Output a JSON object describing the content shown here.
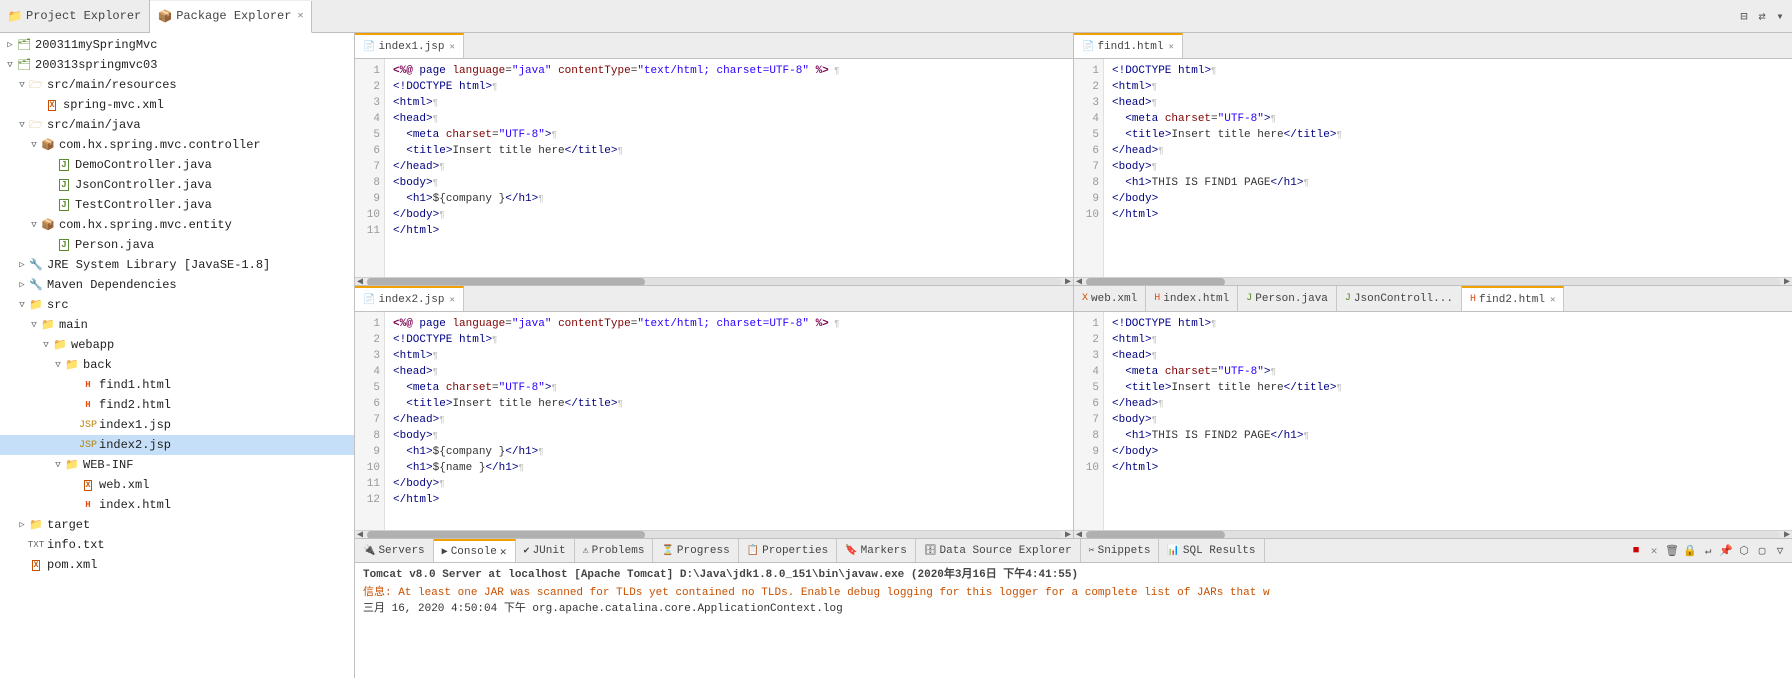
{
  "tabs": {
    "project_explorer": "Project Explorer",
    "package_explorer": "Package Explorer"
  },
  "toolbar": {
    "collapse": "⊟",
    "sync": "⇄",
    "menu": "▾"
  },
  "sidebar": {
    "items": [
      {
        "id": "200311mySpringMvc",
        "label": "200311mySpringMvc",
        "level": 0,
        "type": "project",
        "expanded": false,
        "arrow": "▷"
      },
      {
        "id": "200313springmvc03",
        "label": "200313springmvc03",
        "level": 0,
        "type": "project",
        "expanded": true,
        "arrow": "▽"
      },
      {
        "id": "src-main-resources",
        "label": "src/main/resources",
        "level": 1,
        "type": "src-folder",
        "expanded": true,
        "arrow": "▽"
      },
      {
        "id": "spring-mvc.xml",
        "label": "spring-mvc.xml",
        "level": 2,
        "type": "xml",
        "expanded": false,
        "arrow": ""
      },
      {
        "id": "src-main-java",
        "label": "src/main/java",
        "level": 1,
        "type": "src-folder",
        "expanded": true,
        "arrow": "▽"
      },
      {
        "id": "com.hx.spring.mvc.controller",
        "label": "com.hx.spring.mvc.controller",
        "level": 2,
        "type": "package",
        "expanded": true,
        "arrow": "▽"
      },
      {
        "id": "DemoController.java",
        "label": "DemoController.java",
        "level": 3,
        "type": "java",
        "expanded": false,
        "arrow": ""
      },
      {
        "id": "JsonController.java",
        "label": "JsonController.java",
        "level": 3,
        "type": "java",
        "expanded": false,
        "arrow": ""
      },
      {
        "id": "TestController.java",
        "label": "TestController.java",
        "level": 3,
        "type": "java",
        "expanded": false,
        "arrow": ""
      },
      {
        "id": "com.hx.spring.mvc.entity",
        "label": "com.hx.spring.mvc.entity",
        "level": 2,
        "type": "package",
        "expanded": true,
        "arrow": "▽"
      },
      {
        "id": "Person.java",
        "label": "Person.java",
        "level": 3,
        "type": "java",
        "expanded": false,
        "arrow": ""
      },
      {
        "id": "JRE-System-Library",
        "label": "JRE System Library [JavaSE-1.8]",
        "level": 1,
        "type": "library",
        "expanded": false,
        "arrow": "▷"
      },
      {
        "id": "Maven-Dependencies",
        "label": "Maven Dependencies",
        "level": 1,
        "type": "library",
        "expanded": false,
        "arrow": "▷"
      },
      {
        "id": "src",
        "label": "src",
        "level": 1,
        "type": "folder",
        "expanded": true,
        "arrow": "▽"
      },
      {
        "id": "main",
        "label": "main",
        "level": 2,
        "type": "folder",
        "expanded": true,
        "arrow": "▽"
      },
      {
        "id": "webapp",
        "label": "webapp",
        "level": 3,
        "type": "folder",
        "expanded": true,
        "arrow": "▽"
      },
      {
        "id": "back",
        "label": "back",
        "level": 4,
        "type": "folder",
        "expanded": true,
        "arrow": "▽"
      },
      {
        "id": "find1.html",
        "label": "find1.html",
        "level": 5,
        "type": "html",
        "expanded": false,
        "arrow": ""
      },
      {
        "id": "find2.html",
        "label": "find2.html",
        "level": 5,
        "type": "html",
        "expanded": false,
        "arrow": ""
      },
      {
        "id": "index1.jsp",
        "label": "index1.jsp",
        "level": 5,
        "type": "jsp",
        "expanded": false,
        "arrow": ""
      },
      {
        "id": "index2.jsp",
        "label": "index2.jsp",
        "level": 5,
        "type": "jsp",
        "expanded": false,
        "arrow": "",
        "selected": true
      },
      {
        "id": "WEB-INF",
        "label": "WEB-INF",
        "level": 4,
        "type": "folder",
        "expanded": true,
        "arrow": "▽"
      },
      {
        "id": "web.xml",
        "label": "web.xml",
        "level": 5,
        "type": "xml",
        "expanded": false,
        "arrow": ""
      },
      {
        "id": "index.html-webinf",
        "label": "index.html",
        "level": 5,
        "type": "html",
        "expanded": false,
        "arrow": ""
      },
      {
        "id": "target",
        "label": "target",
        "level": 1,
        "type": "folder",
        "expanded": false,
        "arrow": "▷"
      },
      {
        "id": "info.txt",
        "label": "info.txt",
        "level": 1,
        "type": "txt",
        "expanded": false,
        "arrow": ""
      },
      {
        "id": "pom.xml",
        "label": "pom.xml",
        "level": 1,
        "type": "xml",
        "expanded": false,
        "arrow": ""
      }
    ]
  },
  "editors": {
    "top_left": {
      "tab_label": "index1.jsp",
      "lines": [
        {
          "n": 1,
          "code": "<%@ page language=\"java\" contentType=\"text/html; charset=UTF-8\" %}"
        },
        {
          "n": 2,
          "code": "<!DOCTYPE html>¶"
        },
        {
          "n": 3,
          "code": "<html>¶"
        },
        {
          "n": 4,
          "code": "<head>¶"
        },
        {
          "n": 5,
          "code": "  <meta charset=\"UTF-8\">¶"
        },
        {
          "n": 6,
          "code": "  <title>Insert title here</title>¶"
        },
        {
          "n": 7,
          "code": "</head>¶"
        },
        {
          "n": 8,
          "code": "<body>¶"
        },
        {
          "n": 9,
          "code": "    <h1>${company }</h1>¶"
        },
        {
          "n": 10,
          "code": "</body>¶"
        },
        {
          "n": 11,
          "code": "</html>"
        }
      ]
    },
    "bottom_left": {
      "tab_label": "index2.jsp",
      "lines": [
        {
          "n": 1,
          "code": "<%@ page language=\"java\" contentType=\"text/html; charset=UTF-8\" %}"
        },
        {
          "n": 2,
          "code": "<!DOCTYPE html>¶"
        },
        {
          "n": 3,
          "code": "<html>¶"
        },
        {
          "n": 4,
          "code": "<head>¶"
        },
        {
          "n": 5,
          "code": "  <meta charset=\"UTF-8\">¶"
        },
        {
          "n": 6,
          "code": "  <title>Insert title here</title>¶"
        },
        {
          "n": 7,
          "code": "</head>¶"
        },
        {
          "n": 8,
          "code": "<body>¶"
        },
        {
          "n": 9,
          "code": "    <h1>${company }</h1>¶"
        },
        {
          "n": 10,
          "code": "    <h1>${name }</h1>¶"
        },
        {
          "n": 11,
          "code": "</body>¶"
        },
        {
          "n": 12,
          "code": "</html>"
        }
      ]
    },
    "top_right": {
      "tab_label": "find1.html",
      "lines": [
        {
          "n": 1,
          "code": "<!DOCTYPE html>¶"
        },
        {
          "n": 2,
          "code": "<html>¶"
        },
        {
          "n": 3,
          "code": "<head>¶"
        },
        {
          "n": 4,
          "code": "  <meta charset=\"UTF-8\">¶"
        },
        {
          "n": 5,
          "code": "  <title>Insert title here</title>¶"
        },
        {
          "n": 6,
          "code": "</head>¶"
        },
        {
          "n": 7,
          "code": "<body>¶"
        },
        {
          "n": 8,
          "code": "  <h1>THIS IS FIND1 PAGE</h1>¶"
        },
        {
          "n": 9,
          "code": "</body>"
        },
        {
          "n": 10,
          "code": "</html>"
        }
      ]
    },
    "bottom_right": {
      "tabs": [
        "web.xml",
        "index.html",
        "Person.java",
        "JsonControll...",
        "find2.html"
      ],
      "active_tab": "find2.html",
      "lines": [
        {
          "n": 1,
          "code": "<!DOCTYPE html>¶"
        },
        {
          "n": 2,
          "code": "<html>¶"
        },
        {
          "n": 3,
          "code": "<head>¶"
        },
        {
          "n": 4,
          "code": "  <meta charset=\"UTF-8\">¶"
        },
        {
          "n": 5,
          "code": "  <title>Insert title here</title>¶"
        },
        {
          "n": 6,
          "code": "</head>¶"
        },
        {
          "n": 7,
          "code": "<body>¶"
        },
        {
          "n": 8,
          "code": "  <h1>THIS IS FIND2 PAGE</h1>¶"
        },
        {
          "n": 9,
          "code": "</body>"
        },
        {
          "n": 10,
          "code": "</html>"
        }
      ]
    }
  },
  "bottom_panel": {
    "tabs": [
      "Servers",
      "Console",
      "JUnit",
      "Problems",
      "Progress",
      "Properties",
      "Markers",
      "Data Source Explorer",
      "Snippets",
      "SQL Results"
    ],
    "active_tab": "Console",
    "console_title": "Tomcat v8.0 Server at localhost [Apache Tomcat] D:\\Java\\jdk1.8.0_151\\bin\\javaw.exe (2020年3月16日 下午4:41:55)",
    "log_line1": "信息: At least one JAR was scanned for TLDs yet contained no TLDs. Enable debug logging for this logger for a complete list of JARs that w",
    "log_line2": "三月 16, 2020 4:50:04 下午 org.apache.catalina.core.ApplicationContext.log"
  }
}
